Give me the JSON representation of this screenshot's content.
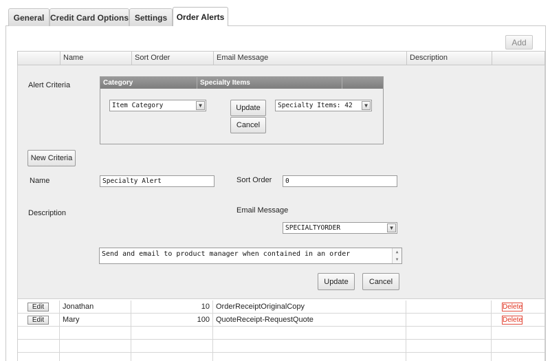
{
  "tabs": [
    {
      "label": "General"
    },
    {
      "label": "Credit Card Options"
    },
    {
      "label": "Settings"
    },
    {
      "label": "Order Alerts"
    }
  ],
  "toolbar": {
    "add_label": "Add"
  },
  "grid": {
    "columns": [
      "",
      "Name",
      "Sort Order",
      "Email Message",
      "Description",
      ""
    ],
    "rows": [
      {
        "edit_label": "Edit",
        "name": "Jonathan",
        "sort_order": "10",
        "email_message": "OrderReceiptOriginalCopy",
        "description": "",
        "delete_label": "Delete"
      },
      {
        "edit_label": "Edit",
        "name": "Mary",
        "sort_order": "100",
        "email_message": "QuoteReceipt-RequestQuote",
        "description": "",
        "delete_label": "Delete"
      }
    ]
  },
  "form": {
    "alert_criteria_label": "Alert Criteria",
    "criteria_table": {
      "col_category": "Category",
      "col_specialty": "Specialty Items",
      "category_select": "Item Category",
      "specialty_select": "Specialty Items: 42",
      "update_label": "Update",
      "cancel_label": "Cancel"
    },
    "new_criteria_label": "New Criteria",
    "name_label": "Name",
    "name_value": "Specialty Alert",
    "sort_order_label": "Sort Order",
    "sort_order_value": "0",
    "description_label": "Description",
    "email_message_label": "Email Message",
    "email_message_select": "SPECIALTYORDER",
    "description_value": "Send and email to product manager when contained in an order",
    "update_label": "Update",
    "cancel_label": "Cancel"
  },
  "icons": {
    "dropdown": "chevron-down-icon",
    "scroll_up": "scroll-up-icon",
    "scroll_down": "scroll-down-icon"
  },
  "colors": {
    "delete": "#e0321e",
    "panel": "#eeeeee",
    "criteria_header": "#8a8a8a"
  }
}
